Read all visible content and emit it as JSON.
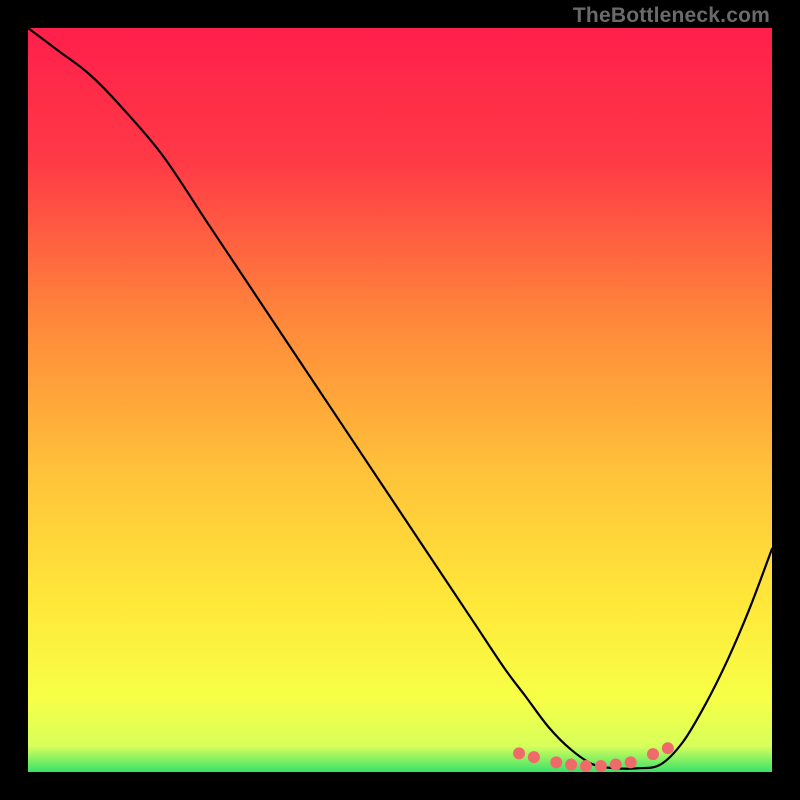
{
  "watermark": "TheBottleneck.com",
  "chart_data": {
    "type": "line",
    "title": "",
    "xlabel": "",
    "ylabel": "",
    "xlim": [
      0,
      100
    ],
    "ylim": [
      0,
      100
    ],
    "gradient_stops": [
      {
        "offset": 0.0,
        "color": "#ff1f4b"
      },
      {
        "offset": 0.18,
        "color": "#ff3a46"
      },
      {
        "offset": 0.4,
        "color": "#ff8a3a"
      },
      {
        "offset": 0.6,
        "color": "#ffc33a"
      },
      {
        "offset": 0.78,
        "color": "#ffe93a"
      },
      {
        "offset": 0.9,
        "color": "#f7ff47"
      },
      {
        "offset": 0.965,
        "color": "#d8ff5a"
      },
      {
        "offset": 1.0,
        "color": "#39e26a"
      }
    ],
    "series": [
      {
        "name": "bottleneck-curve",
        "color": "#000000",
        "x": [
          0,
          4,
          8,
          12,
          18,
          24,
          30,
          36,
          42,
          48,
          54,
          60,
          64,
          67,
          70,
          73,
          76,
          79,
          82,
          85,
          88,
          91,
          94,
          97,
          100
        ],
        "y": [
          100,
          97,
          94,
          90,
          83,
          74,
          65,
          56,
          47,
          38,
          29,
          20,
          14,
          10,
          6,
          3,
          1,
          0.5,
          0.5,
          1,
          4,
          9,
          15,
          22,
          30
        ]
      }
    ],
    "markers": {
      "name": "sweet-spot-dots",
      "color": "#f06a6a",
      "radius": 6,
      "x": [
        66,
        68,
        71,
        73,
        75,
        77,
        79,
        81,
        84,
        86
      ],
      "y": [
        2.5,
        2.0,
        1.3,
        1.0,
        0.8,
        0.8,
        1.0,
        1.3,
        2.4,
        3.2
      ]
    }
  }
}
